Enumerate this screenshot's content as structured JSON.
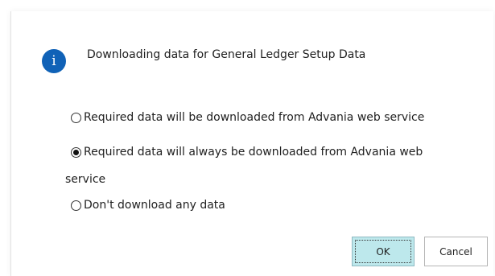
{
  "dialog": {
    "message": "Downloading data for General Ledger Setup Data",
    "icon": "info-icon",
    "options": [
      {
        "label": "Required data will be downloaded from Advania web service",
        "selected": false
      },
      {
        "label": "Required data will always be downloaded from Advania web",
        "label_continued": "service",
        "selected": true
      },
      {
        "label": "Don't download any data",
        "selected": false
      }
    ],
    "buttons": {
      "ok_label": "OK",
      "cancel_label": "Cancel"
    }
  },
  "colors": {
    "info_icon": "#1062b7",
    "ok_button": "#bde8ec",
    "text": "#212121"
  }
}
